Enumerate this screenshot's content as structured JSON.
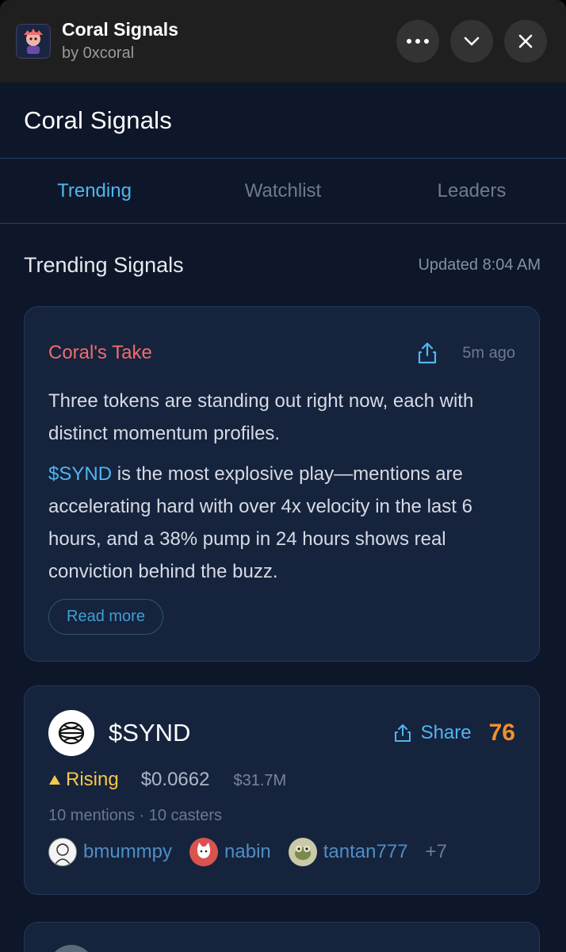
{
  "app": {
    "title": "Coral Signals",
    "author": "by 0xcoral"
  },
  "header": {
    "title": "Coral Signals"
  },
  "tabs": [
    {
      "label": "Trending",
      "active": true
    },
    {
      "label": "Watchlist",
      "active": false
    },
    {
      "label": "Leaders",
      "active": false
    }
  ],
  "section": {
    "title": "Trending Signals",
    "updated": "Updated 8:04 AM"
  },
  "take": {
    "title": "Coral's Take",
    "time": "5m ago",
    "p1": "Three tokens are standing out right now, each with distinct momentum profiles.",
    "ticker": "$SYND",
    "p2_rest": " is the most explosive play—mentions are accelerating hard with over 4x velocity in the last 6 hours, and a 38% pump in 24 hours shows real conviction behind the buzz.",
    "read_more": "Read more"
  },
  "token": {
    "name": "$SYND",
    "share_label": "Share",
    "score": "76",
    "trend": "Rising",
    "price": "$0.0662",
    "market_cap": "$31.7M",
    "mentions": "10 mentions · 10 casters",
    "casters": [
      {
        "name": "bmummpy"
      },
      {
        "name": "nabin"
      },
      {
        "name": "tantan777"
      }
    ],
    "more": "+7"
  },
  "colors": {
    "accent": "#4fb6f2",
    "take_title": "#f06b6b",
    "score": "#f0902e",
    "rising": "#f5c84a",
    "background": "#0e1729",
    "card": "#15233d"
  },
  "icons": {
    "more": "ellipsis-icon",
    "collapse": "chevron-down-icon",
    "close": "close-icon",
    "share": "share-icon",
    "trend": "triangle-up-icon"
  }
}
